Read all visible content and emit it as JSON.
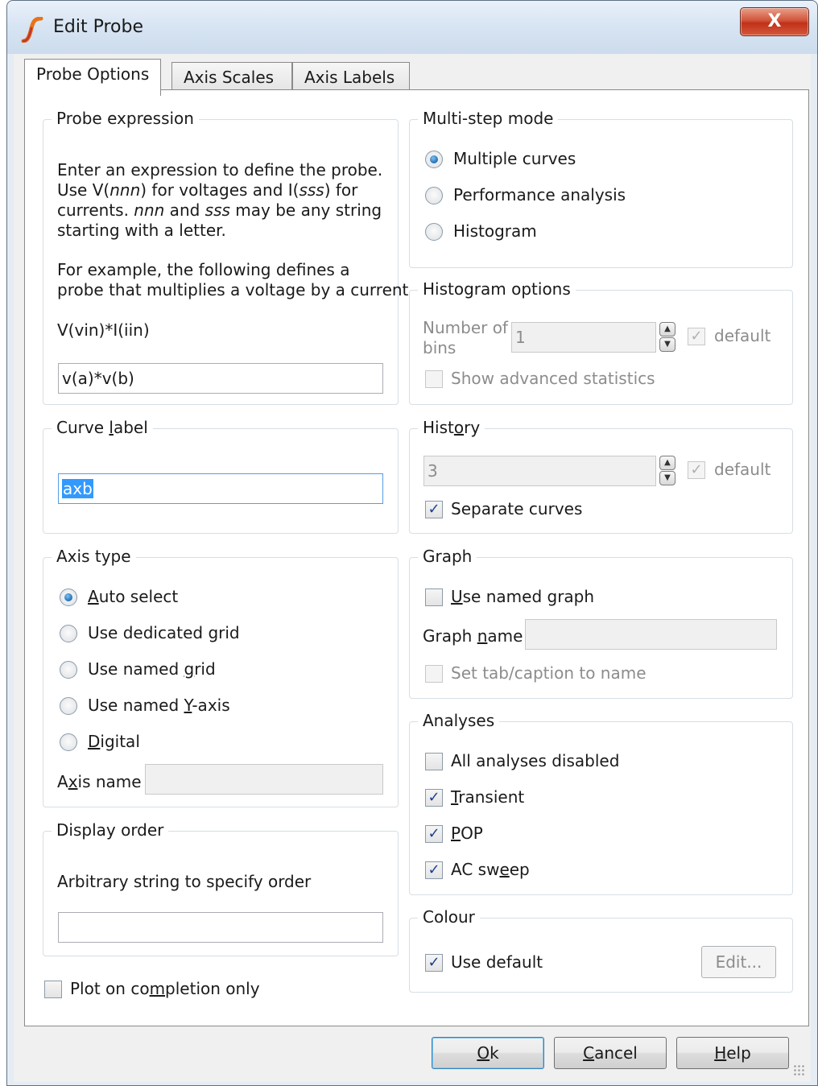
{
  "window": {
    "title": "Edit Probe",
    "close_label": "X"
  },
  "tabs": [
    {
      "label": "Probe Options"
    },
    {
      "label": "Axis Scales"
    },
    {
      "label": "Axis Labels"
    }
  ],
  "probe_expression": {
    "legend": "Probe expression",
    "desc_line1": "Enter an expression to define the probe.",
    "desc_line2_a": "Use V(",
    "desc_line2_nnn": "nnn",
    "desc_line2_b": ") for voltages and I(",
    "desc_line2_sss": "sss",
    "desc_line2_c": ") for",
    "desc_line3_a": "currents. ",
    "desc_line3_nnn": "nnn",
    "desc_line3_b": " and ",
    "desc_line3_sss": "sss",
    "desc_line3_c": " may be any string",
    "desc_line4": "starting with a letter.",
    "example_line1": "For example, the following defines a",
    "example_line2": "probe that multiplies a voltage by a current",
    "example_expr": "V(vin)*I(iin)",
    "value": "v(a)*v(b)"
  },
  "curve_label": {
    "legend_a": "Curve ",
    "legend_u": "l",
    "legend_b": "abel",
    "value": "axb"
  },
  "axis_type": {
    "legend": "Axis type",
    "options": [
      {
        "pre": "",
        "u": "A",
        "post": "uto select"
      },
      {
        "pre": "Use dedicated ",
        "u": "",
        "post": "grid"
      },
      {
        "pre": "Use named ",
        "u": "g",
        "post": "rid"
      },
      {
        "pre": "Use named ",
        "u": "Y",
        "post": "-axis"
      },
      {
        "pre": "",
        "u": "D",
        "post": "igital"
      }
    ],
    "axis_name_label_a": "A",
    "axis_name_label_u": "x",
    "axis_name_label_b": "is name",
    "axis_name_value": ""
  },
  "display_order": {
    "legend": "Display order",
    "desc": "Arbitrary string to specify order",
    "value": ""
  },
  "plot_on_completion": {
    "pre": "Plot on co",
    "u": "m",
    "post": "pletion only"
  },
  "multi_step": {
    "legend": "Multi-step mode",
    "options": [
      "Multiple curves",
      "Performance analysis",
      "Histogram"
    ]
  },
  "histogram": {
    "legend": "Histogram options",
    "bins_label_1": "Number of",
    "bins_label_2": "bins",
    "bins_value": "1",
    "default_label": "default",
    "advanced_label": "Show advanced statistics"
  },
  "history": {
    "legend_a": "Hist",
    "legend_u": "o",
    "legend_b": "ry",
    "value": "3",
    "default_label": "default",
    "separate_label": "Separate curves"
  },
  "graph": {
    "legend": "Graph",
    "use_named_pre": "",
    "use_named_u": "U",
    "use_named_post": "se named graph",
    "name_label_pre": "Graph ",
    "name_label_u": "n",
    "name_label_post": "ame",
    "name_value": "",
    "set_tab_label": "Set tab/caption to name"
  },
  "analyses": {
    "legend": "Analyses",
    "items": [
      {
        "pre": "All analyses disabled",
        "u": "",
        "post": ""
      },
      {
        "pre": "",
        "u": "T",
        "post": "ransient"
      },
      {
        "pre": "",
        "u": "P",
        "post": "OP"
      },
      {
        "pre": "AC sw",
        "u": "e",
        "post": "ep"
      }
    ]
  },
  "colour": {
    "legend": "Colour",
    "use_default": "Use default",
    "edit_label": "Edit..."
  },
  "buttons": {
    "ok_u": "O",
    "ok_post": "k",
    "cancel_u": "C",
    "cancel_post": "ancel",
    "help_u": "H",
    "help_post": "elp"
  }
}
